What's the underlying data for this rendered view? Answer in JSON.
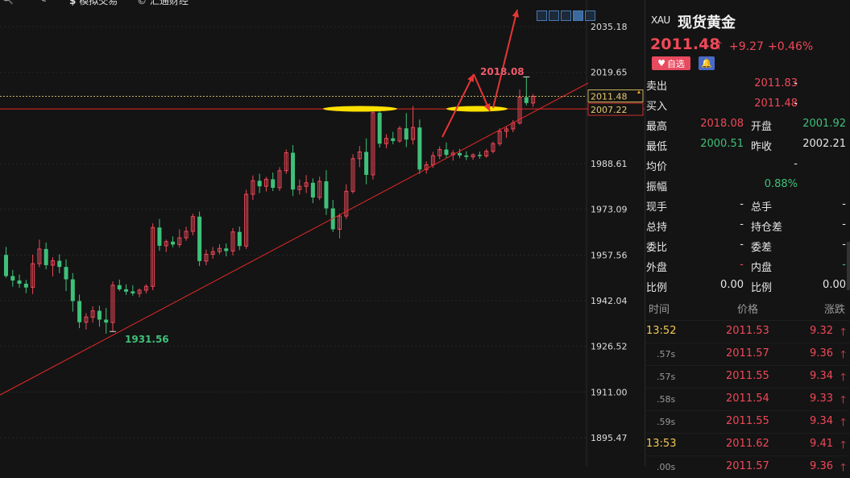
{
  "topbar": {
    "item1_label": "模拟交易",
    "item2_label": "汇通财经"
  },
  "chart": {
    "y_ticks": [
      "2035.18",
      "2019.65",
      "1988.61",
      "1973.09",
      "1957.56",
      "1942.04",
      "1926.52",
      "1911.00",
      "1895.47"
    ],
    "current_price_tag": "2011.48",
    "ref_price_tag": "2007.22",
    "high_annotation": "2018.08",
    "low_annotation": "1931.56"
  },
  "chart_data": {
    "type": "candlestick",
    "title": "",
    "y_axis_ticks": [
      2035.18,
      2019.65,
      1988.61,
      1973.09,
      1957.56,
      1942.04,
      1926.52,
      1911.0,
      1895.47
    ],
    "annotated_high": 2018.08,
    "annotated_low": 1931.56,
    "last_price": 2011.48,
    "ref_line": 2007.22,
    "colors": {
      "up": "#3fc07a",
      "down": "#f04858",
      "trend": "#e62828",
      "highlight": "#ffe100"
    }
  },
  "quote": {
    "symbol": "XAU",
    "name": "现货黄金",
    "price": "2011.48",
    "change": "+9.27",
    "change_pct": "+0.46%",
    "fav_label": "自选",
    "rows": [
      {
        "l1": "卖出",
        "v1": "2011.83",
        "c1": "red",
        "l2": "",
        "v2": "-",
        "c2": "white"
      },
      {
        "l1": "买入",
        "v1": "2011.48",
        "c1": "red",
        "l2": "",
        "v2": "-",
        "c2": "white"
      },
      {
        "l1": "最高",
        "v1": "2018.08",
        "c1": "red",
        "l2": "开盘",
        "v2": "2001.92",
        "c2": "green"
      },
      {
        "l1": "最低",
        "v1": "2000.51",
        "c1": "green",
        "l2": "昨收",
        "v2": "2002.21",
        "c2": "white"
      },
      {
        "l1": "均价",
        "v1": "-",
        "c1": "white",
        "l2": "",
        "v2": "",
        "c2": "white"
      },
      {
        "l1": "振幅",
        "v1": "0.88%",
        "c1": "green",
        "l2": "",
        "v2": "",
        "c2": "white"
      },
      {
        "l1": "现手",
        "v1": "-",
        "c1": "white",
        "l2": "总手",
        "v2": "-",
        "c2": "white"
      },
      {
        "l1": "总持",
        "v1": "-",
        "c1": "white",
        "l2": "持仓差",
        "v2": "-",
        "c2": "white"
      },
      {
        "l1": "委比",
        "v1": "-",
        "c1": "white",
        "l2": "委差",
        "v2": "-",
        "c2": "white"
      },
      {
        "l1": "外盘",
        "v1": "-",
        "c1": "red",
        "l2": "内盘",
        "v2": "-",
        "c2": "green"
      },
      {
        "l1": "比例",
        "v1": "0.00",
        "c1": "white",
        "l2": "比例",
        "v2": "0.00",
        "c2": "white"
      }
    ],
    "ticks_header": {
      "time": "时间",
      "price": "价格",
      "change": "涨跌"
    },
    "ticks": [
      {
        "time": "13:52",
        "sec": false,
        "price": "2011.53",
        "chg": "9.32"
      },
      {
        "time": ".57s",
        "sec": true,
        "price": "2011.57",
        "chg": "9.36"
      },
      {
        "time": ".57s",
        "sec": true,
        "price": "2011.55",
        "chg": "9.34"
      },
      {
        "time": ".58s",
        "sec": true,
        "price": "2011.54",
        "chg": "9.33"
      },
      {
        "time": ".59s",
        "sec": true,
        "price": "2011.55",
        "chg": "9.34"
      },
      {
        "time": "13:53",
        "sec": false,
        "price": "2011.62",
        "chg": "9.41"
      },
      {
        "time": ".00s",
        "sec": true,
        "price": "2011.57",
        "chg": "9.36"
      }
    ]
  }
}
